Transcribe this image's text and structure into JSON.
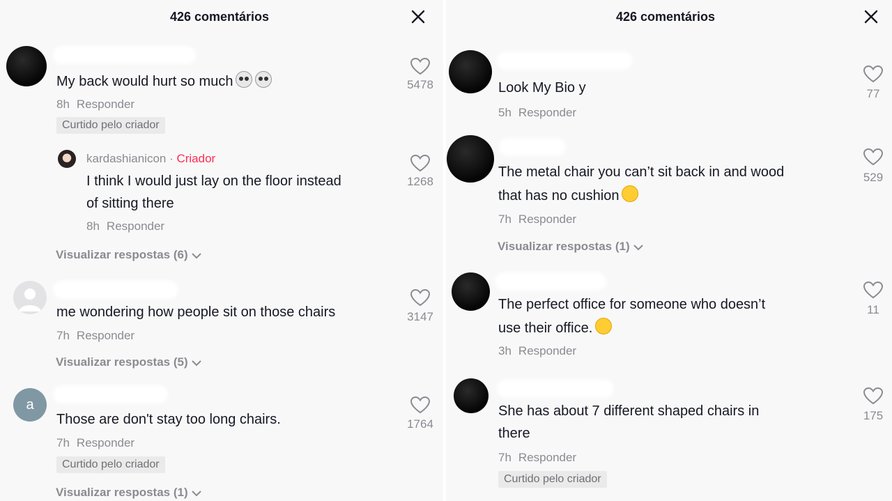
{
  "panels": [
    {
      "header": {
        "title": "426 comentários"
      },
      "comments": [
        {
          "text": "My back would hurt so much",
          "time": "8h",
          "reply": "Responder",
          "badge": "Curtido pelo criador",
          "likes": "5478",
          "emoji": [
            "skull",
            "skull"
          ],
          "avatar": "black"
        },
        {
          "creator_name": "kardashianicon",
          "creator_tag": "Criador",
          "text_lines": [
            "I think I would just lay on the floor instead",
            "of sitting there"
          ],
          "time": "8h",
          "reply": "Responder",
          "likes": "1268"
        },
        {
          "view_replies": "Visualizar respostas (6)"
        },
        {
          "text": "me wondering how people sit on those chairs",
          "time": "7h",
          "reply": "Responder",
          "likes": "3147",
          "avatar": "gray",
          "view_replies": "Visualizar respostas (5)"
        },
        {
          "text": "Those are don't stay too long chairs.",
          "time": "7h",
          "reply": "Responder",
          "badge": "Curtido pelo criador",
          "likes": "1764",
          "avatar_letter": "a",
          "view_replies": "Visualizar respostas (1)"
        }
      ]
    },
    {
      "header": {
        "title": "426 comentários"
      },
      "comments": [
        {
          "text": "Look My Bio y",
          "time": "5h",
          "reply": "Responder",
          "likes": "77"
        },
        {
          "text_lines": [
            "The metal chair you can’t sit back in and wood",
            "that has no cushion"
          ],
          "time": "7h",
          "reply": "Responder",
          "likes": "529",
          "view_replies": "Visualizar respostas (1)",
          "emoji": [
            "rolling-laughing"
          ]
        },
        {
          "text_lines": [
            "The perfect office for someone who doesn’t",
            "use their office."
          ],
          "time": "3h",
          "reply": "Responder",
          "likes": "11",
          "emoji": [
            "laughing"
          ]
        },
        {
          "text_lines": [
            "She has about 7 different shaped chairs in",
            "there"
          ],
          "time": "7h",
          "reply": "Responder",
          "badge": "Curtido pelo criador",
          "likes": "175"
        }
      ]
    }
  ],
  "icons": {
    "close": "close-icon",
    "like": "heart-outline-icon",
    "expand": "chevron-down-icon"
  },
  "colors": {
    "creator_tag": "#fe2c55",
    "muted_text": "#8a8b91",
    "text": "#161823"
  }
}
